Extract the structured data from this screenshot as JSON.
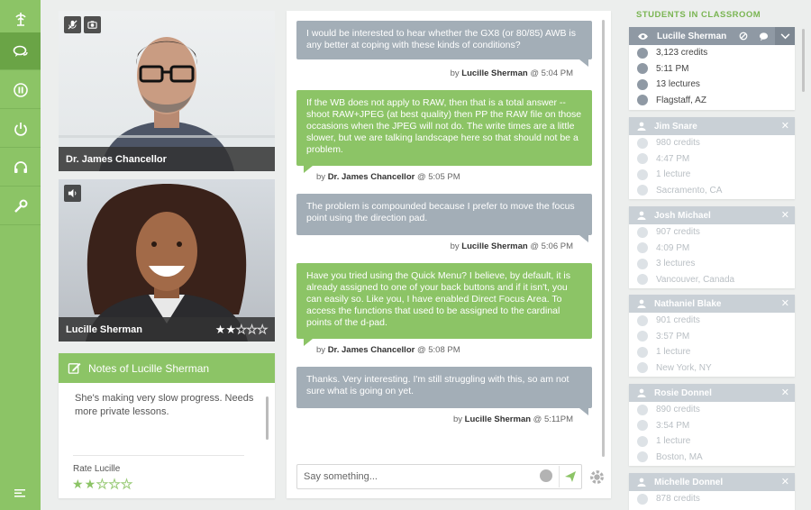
{
  "rail": {
    "items": [
      "logo",
      "chat",
      "pause",
      "power",
      "headset",
      "wrench"
    ],
    "bottom_icon": "menu"
  },
  "videos": [
    {
      "name": "Dr. James Chancellor",
      "buttons": [
        "mic-off-icon",
        "camera-icon"
      ]
    },
    {
      "name": "Lucille Sherman",
      "buttons": [
        "speaker-icon"
      ],
      "rating": 2,
      "rating_max": 5
    }
  ],
  "notes": {
    "title": "Notes of Lucille Sherman",
    "text": "She's making very slow progress. Needs more private lessons.",
    "rate_label": "Rate Lucille",
    "rating": 2,
    "rating_max": 5
  },
  "chat": {
    "messages": [
      {
        "style": "gray",
        "text": "I would be interested to hear whether the GX8 (or 80/85) AWB is any better at coping with these kinds of conditions?",
        "by": "by",
        "author": "Lucille Sherman",
        "time": "@ 5:04 PM"
      },
      {
        "style": "green",
        "text": "If the WB does not apply to RAW, then that is a total answer -- shoot RAW+JPEG (at best quality) then PP the RAW file on those occasions when the JPEG will not do. The write times are a little slower, but we are talking landscape here so that should not be a problem.",
        "by": "by",
        "author": "Dr. James Chancellor",
        "time": "@ 5:05 PM"
      },
      {
        "style": "gray",
        "text": "The problem is compounded because I prefer to move the focus point using the direction pad.",
        "by": "by",
        "author": "Lucille Sherman",
        "time": "@ 5:06 PM"
      },
      {
        "style": "green",
        "text": "Have you tried using the Quick Menu?  I believe, by default, it is already assigned to one of your back buttons and if it isn't, you can easily so.  Like you, I have enabled Direct Focus Area. To access the functions that used to be assigned to the cardinal points of the d-pad.",
        "by": "by",
        "author": "Dr. James Chancellor",
        "time": "@ 5:08 PM"
      },
      {
        "style": "gray",
        "text": "Thanks.  Very interesting.  I'm still struggling with this, so am not sure what is going on yet.",
        "by": "by",
        "author": "Lucille Sherman",
        "time": "@ 5:11PM"
      }
    ],
    "input_placeholder": "Say something..."
  },
  "sidebar": {
    "title": "STUDENTS IN CLASSROOM",
    "students": [
      {
        "name": "Lucille Sherman",
        "credits": "3,123 credits",
        "time": "5:11 PM",
        "lectures": "13 lectures",
        "location": "Flagstaff, AZ",
        "active": true
      },
      {
        "name": "Jim Snare",
        "credits": "980 credits",
        "time": "4:47 PM",
        "lectures": "1 lecture",
        "location": "Sacramento, CA",
        "active": false
      },
      {
        "name": "Josh Michael",
        "credits": "907 credits",
        "time": "4:09 PM",
        "lectures": "3 lectures",
        "location": "Vancouver, Canada",
        "active": false
      },
      {
        "name": "Nathaniel Blake",
        "credits": "901 credits",
        "time": "3:57 PM",
        "lectures": "1 lecture",
        "location": "New York, NY",
        "active": false
      },
      {
        "name": "Rosie Donnel",
        "credits": "890 credits",
        "time": "3:54 PM",
        "lectures": "1 lecture",
        "location": "Boston, MA",
        "active": false
      },
      {
        "name": "Michelle Donnel",
        "credits": "878 credits",
        "time": "",
        "lectures": "",
        "location": "",
        "active": false
      }
    ]
  },
  "colors": {
    "green": "#8cc466",
    "green_dark": "#6aa446",
    "gray_bubble": "#a3aeb7",
    "header_active": "#8f99a4"
  }
}
